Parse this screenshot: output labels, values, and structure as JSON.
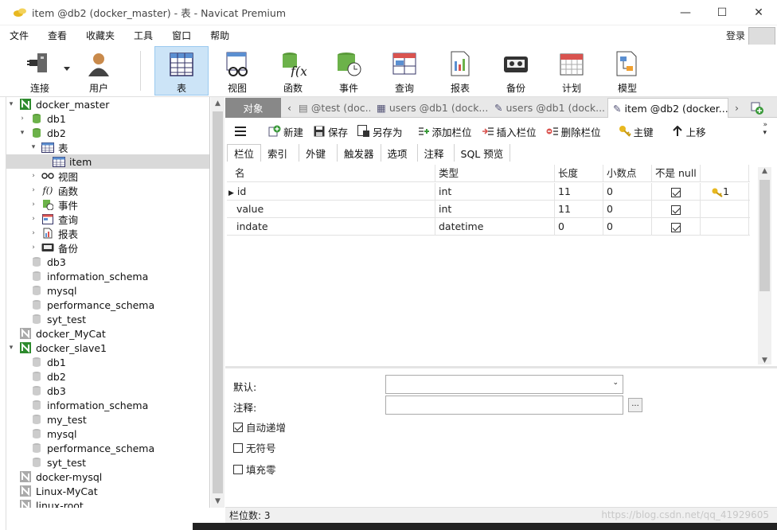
{
  "window": {
    "title": "item @db2 (docker_master) - 表 - Navicat Premium"
  },
  "window_controls": {
    "minimize": "—",
    "maximize": "☐",
    "close": "✕"
  },
  "menu": {
    "items": [
      "文件",
      "查看",
      "收藏夹",
      "工具",
      "窗口",
      "帮助"
    ],
    "login": "登录"
  },
  "toolbar": {
    "buttons": [
      {
        "label": "连接",
        "icon": "plug-icon"
      },
      {
        "label": "用户",
        "icon": "user-icon"
      },
      {
        "label": "表",
        "icon": "table-icon"
      },
      {
        "label": "视图",
        "icon": "view-icon"
      },
      {
        "label": "函数",
        "icon": "function-icon"
      },
      {
        "label": "事件",
        "icon": "event-icon"
      },
      {
        "label": "查询",
        "icon": "query-icon"
      },
      {
        "label": "报表",
        "icon": "report-icon"
      },
      {
        "label": "备份",
        "icon": "backup-icon"
      },
      {
        "label": "计划",
        "icon": "calendar-icon"
      },
      {
        "label": "模型",
        "icon": "model-icon"
      }
    ]
  },
  "tree": {
    "items": [
      {
        "label": "docker_master",
        "icon": "connection-icon"
      },
      {
        "label": "db1",
        "icon": "database-icon"
      },
      {
        "label": "db2",
        "icon": "database-icon"
      },
      {
        "label": "表",
        "icon": "tables-icon"
      },
      {
        "label": "item",
        "icon": "table-icon"
      },
      {
        "label": "视图",
        "icon": "view-icon"
      },
      {
        "label": "函数",
        "icon": "function-icon"
      },
      {
        "label": "事件",
        "icon": "event-icon"
      },
      {
        "label": "查询",
        "icon": "query-icon"
      },
      {
        "label": "报表",
        "icon": "report-icon"
      },
      {
        "label": "备份",
        "icon": "backup-icon"
      },
      {
        "label": "db3",
        "icon": "database-icon"
      },
      {
        "label": "information_schema",
        "icon": "database-icon"
      },
      {
        "label": "mysql",
        "icon": "database-icon"
      },
      {
        "label": "performance_schema",
        "icon": "database-icon"
      },
      {
        "label": "syt_test",
        "icon": "database-icon"
      },
      {
        "label": "docker_MyCat",
        "icon": "connection-icon"
      },
      {
        "label": "docker_slave1",
        "icon": "connection-icon"
      },
      {
        "label": "db1",
        "icon": "database-icon"
      },
      {
        "label": "db2",
        "icon": "database-icon"
      },
      {
        "label": "db3",
        "icon": "database-icon"
      },
      {
        "label": "information_schema",
        "icon": "database-icon"
      },
      {
        "label": "my_test",
        "icon": "database-icon"
      },
      {
        "label": "mysql",
        "icon": "database-icon"
      },
      {
        "label": "performance_schema",
        "icon": "database-icon"
      },
      {
        "label": "syt_test",
        "icon": "database-icon"
      },
      {
        "label": "docker-mysql",
        "icon": "connection-icon"
      },
      {
        "label": "Linux-MyCat",
        "icon": "connection-icon"
      },
      {
        "label": "linux-root",
        "icon": "connection-icon"
      }
    ]
  },
  "tabs": {
    "object": "对象",
    "items": [
      "@test (doc...",
      "users @db1 (dock...",
      "users @db1 (dock...",
      "item @db2 (docker..."
    ]
  },
  "objbar": {
    "new": "新建",
    "save": "保存",
    "save_as": "另存为",
    "add_field": "添加栏位",
    "insert_field": "插入栏位",
    "delete_field": "删除栏位",
    "primary_key": "主键",
    "move_up": "上移"
  },
  "subtabs": [
    "栏位",
    "索引",
    "外键",
    "触发器",
    "选项",
    "注释",
    "SQL 预览"
  ],
  "grid": {
    "headers": [
      "名",
      "类型",
      "长度",
      "小数点",
      "不是 null",
      ""
    ],
    "rows": [
      {
        "name": "id",
        "type": "int",
        "length": "11",
        "decimals": "0",
        "not_null": true,
        "key": "1"
      },
      {
        "name": "value",
        "type": "int",
        "length": "11",
        "decimals": "0",
        "not_null": true,
        "key": ""
      },
      {
        "name": "indate",
        "type": "datetime",
        "length": "0",
        "decimals": "0",
        "not_null": true,
        "key": ""
      }
    ]
  },
  "props": {
    "default_label": "默认:",
    "comment_label": "注释:",
    "default_value": "",
    "comment_value": "",
    "auto_increment": "自动递增",
    "unsigned": "无符号",
    "zerofill": "填充零",
    "ellipsis": "..."
  },
  "status": {
    "field_count": "栏位数: 3"
  },
  "watermark": "https://blog.csdn.net/qq_41929605"
}
